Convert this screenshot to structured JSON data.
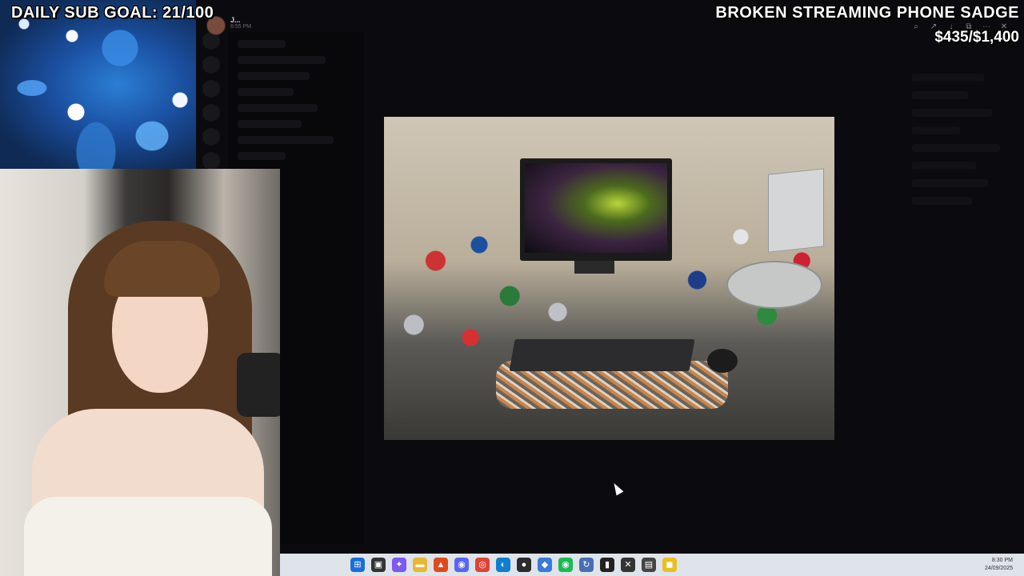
{
  "overlay": {
    "sub_goal": "DAILY SUB GOAL: 21/100",
    "banner": "BROKEN STREAMING PHONE SADGE",
    "money": "$435/$1,400"
  },
  "message": {
    "user": "J...",
    "time": "6:55 PM"
  },
  "lightbox_tools": [
    "search-icon",
    "share-icon",
    "download-icon",
    "external-icon",
    "more-icon",
    "close-icon"
  ],
  "taskbar": {
    "icons": [
      {
        "name": "start-icon",
        "glyph": "⊞",
        "color": "#1a6fd6"
      },
      {
        "name": "taskview-icon",
        "glyph": "▣",
        "color": "#333333"
      },
      {
        "name": "copilot-icon",
        "glyph": "✦",
        "color": "#7a5af0"
      },
      {
        "name": "explorer-icon",
        "glyph": "▬",
        "color": "#e8b830"
      },
      {
        "name": "brave-icon",
        "glyph": "▲",
        "color": "#e04a1a"
      },
      {
        "name": "discord-icon",
        "glyph": "◉",
        "color": "#5865f2"
      },
      {
        "name": "chrome-icon",
        "glyph": "◎",
        "color": "#db4437"
      },
      {
        "name": "edge-icon",
        "glyph": "◐",
        "color": "#0e7fd0"
      },
      {
        "name": "obs-icon",
        "glyph": "●",
        "color": "#2b2b2b"
      },
      {
        "name": "app-icon",
        "glyph": "◆",
        "color": "#3a7ad8"
      },
      {
        "name": "spotify-icon",
        "glyph": "◉",
        "color": "#1db954"
      },
      {
        "name": "sync-icon",
        "glyph": "↻",
        "color": "#4a6fb0"
      },
      {
        "name": "terminal-icon",
        "glyph": "▮",
        "color": "#222222"
      },
      {
        "name": "tool-icon",
        "glyph": "✕",
        "color": "#333333"
      },
      {
        "name": "console-icon",
        "glyph": "▤",
        "color": "#444444"
      },
      {
        "name": "notes-icon",
        "glyph": "◼",
        "color": "#e8c020"
      }
    ],
    "time": "8:30 PM",
    "date": "24/09/2025"
  }
}
